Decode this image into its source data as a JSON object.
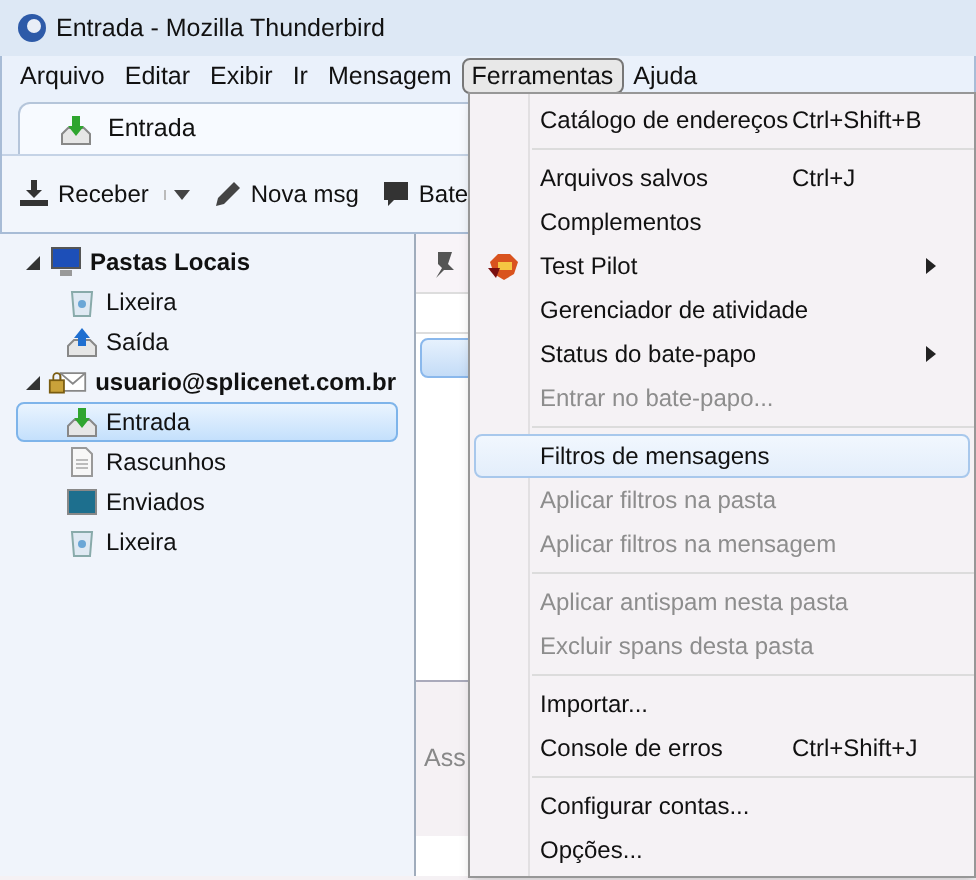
{
  "window": {
    "title": "Entrada - Mozilla Thunderbird"
  },
  "menubar": [
    {
      "label": "Arquivo",
      "selected": false
    },
    {
      "label": "Editar",
      "selected": false
    },
    {
      "label": "Exibir",
      "selected": false
    },
    {
      "label": "Ir",
      "selected": false
    },
    {
      "label": "Mensagem",
      "selected": false
    },
    {
      "label": "Ferramentas",
      "selected": true
    },
    {
      "label": "Ajuda",
      "selected": false
    }
  ],
  "tabs": [
    {
      "label": "Entrada",
      "selected": true
    }
  ],
  "toolbar": [
    {
      "label": "Receber",
      "kind": "receive"
    },
    {
      "label": "Nova msg",
      "kind": "write"
    },
    {
      "label": "Bate",
      "kind": "chat"
    }
  ],
  "folders": [
    {
      "label": "Pastas Locais",
      "kind": "computer",
      "expanded": true,
      "selected": false,
      "children": [
        {
          "label": "Lixeira",
          "kind": "trash",
          "selected": false
        },
        {
          "label": "Saída",
          "kind": "outbox",
          "selected": false
        }
      ]
    },
    {
      "label": "usuario@splicenet.com.br",
      "kind": "account",
      "expanded": true,
      "selected": false,
      "children": [
        {
          "label": "Entrada",
          "kind": "inbox",
          "selected": true
        },
        {
          "label": "Rascunhos",
          "kind": "drafts",
          "selected": false
        },
        {
          "label": "Enviados",
          "kind": "sent",
          "selected": false
        },
        {
          "label": "Lixeira",
          "kind": "trash",
          "selected": false
        }
      ]
    }
  ],
  "preview": {
    "text": "Ass"
  },
  "menu": [
    {
      "label": "Catálogo de endereços",
      "shortcut": "Ctrl+Shift+B",
      "kind": "item",
      "disabled": false,
      "selected": false
    },
    {
      "kind": "separator"
    },
    {
      "label": "Arquivos salvos",
      "shortcut": "Ctrl+J",
      "kind": "item",
      "disabled": false,
      "selected": false
    },
    {
      "label": "Complementos",
      "kind": "item",
      "disabled": false,
      "selected": false
    },
    {
      "label": "Test Pilot",
      "kind": "submenu",
      "disabled": false,
      "selected": false,
      "icon": true
    },
    {
      "label": "Gerenciador de atividade",
      "kind": "item",
      "disabled": false,
      "selected": false
    },
    {
      "label": "Status do bate-papo",
      "kind": "submenu",
      "disabled": false,
      "selected": false
    },
    {
      "label": "Entrar no bate-papo...",
      "kind": "item",
      "disabled": true,
      "selected": false
    },
    {
      "kind": "separator"
    },
    {
      "label": "Filtros de mensagens",
      "kind": "item",
      "disabled": false,
      "selected": true
    },
    {
      "label": "Aplicar filtros na pasta",
      "kind": "item",
      "disabled": true,
      "selected": false
    },
    {
      "label": "Aplicar filtros na mensagem",
      "kind": "item",
      "disabled": true,
      "selected": false
    },
    {
      "kind": "separator"
    },
    {
      "label": "Aplicar antispam nesta pasta",
      "kind": "item",
      "disabled": true,
      "selected": false
    },
    {
      "label": "Excluir spans desta pasta",
      "kind": "item",
      "disabled": true,
      "selected": false
    },
    {
      "kind": "separator"
    },
    {
      "label": "Importar...",
      "kind": "item",
      "disabled": false,
      "selected": false
    },
    {
      "label": "Console de erros",
      "shortcut": "Ctrl+Shift+J",
      "kind": "item",
      "disabled": false,
      "selected": false
    },
    {
      "kind": "separator"
    },
    {
      "label": "Configurar contas...",
      "kind": "item",
      "disabled": false,
      "selected": false
    },
    {
      "label": "Opções...",
      "kind": "item",
      "disabled": false,
      "selected": false
    }
  ]
}
